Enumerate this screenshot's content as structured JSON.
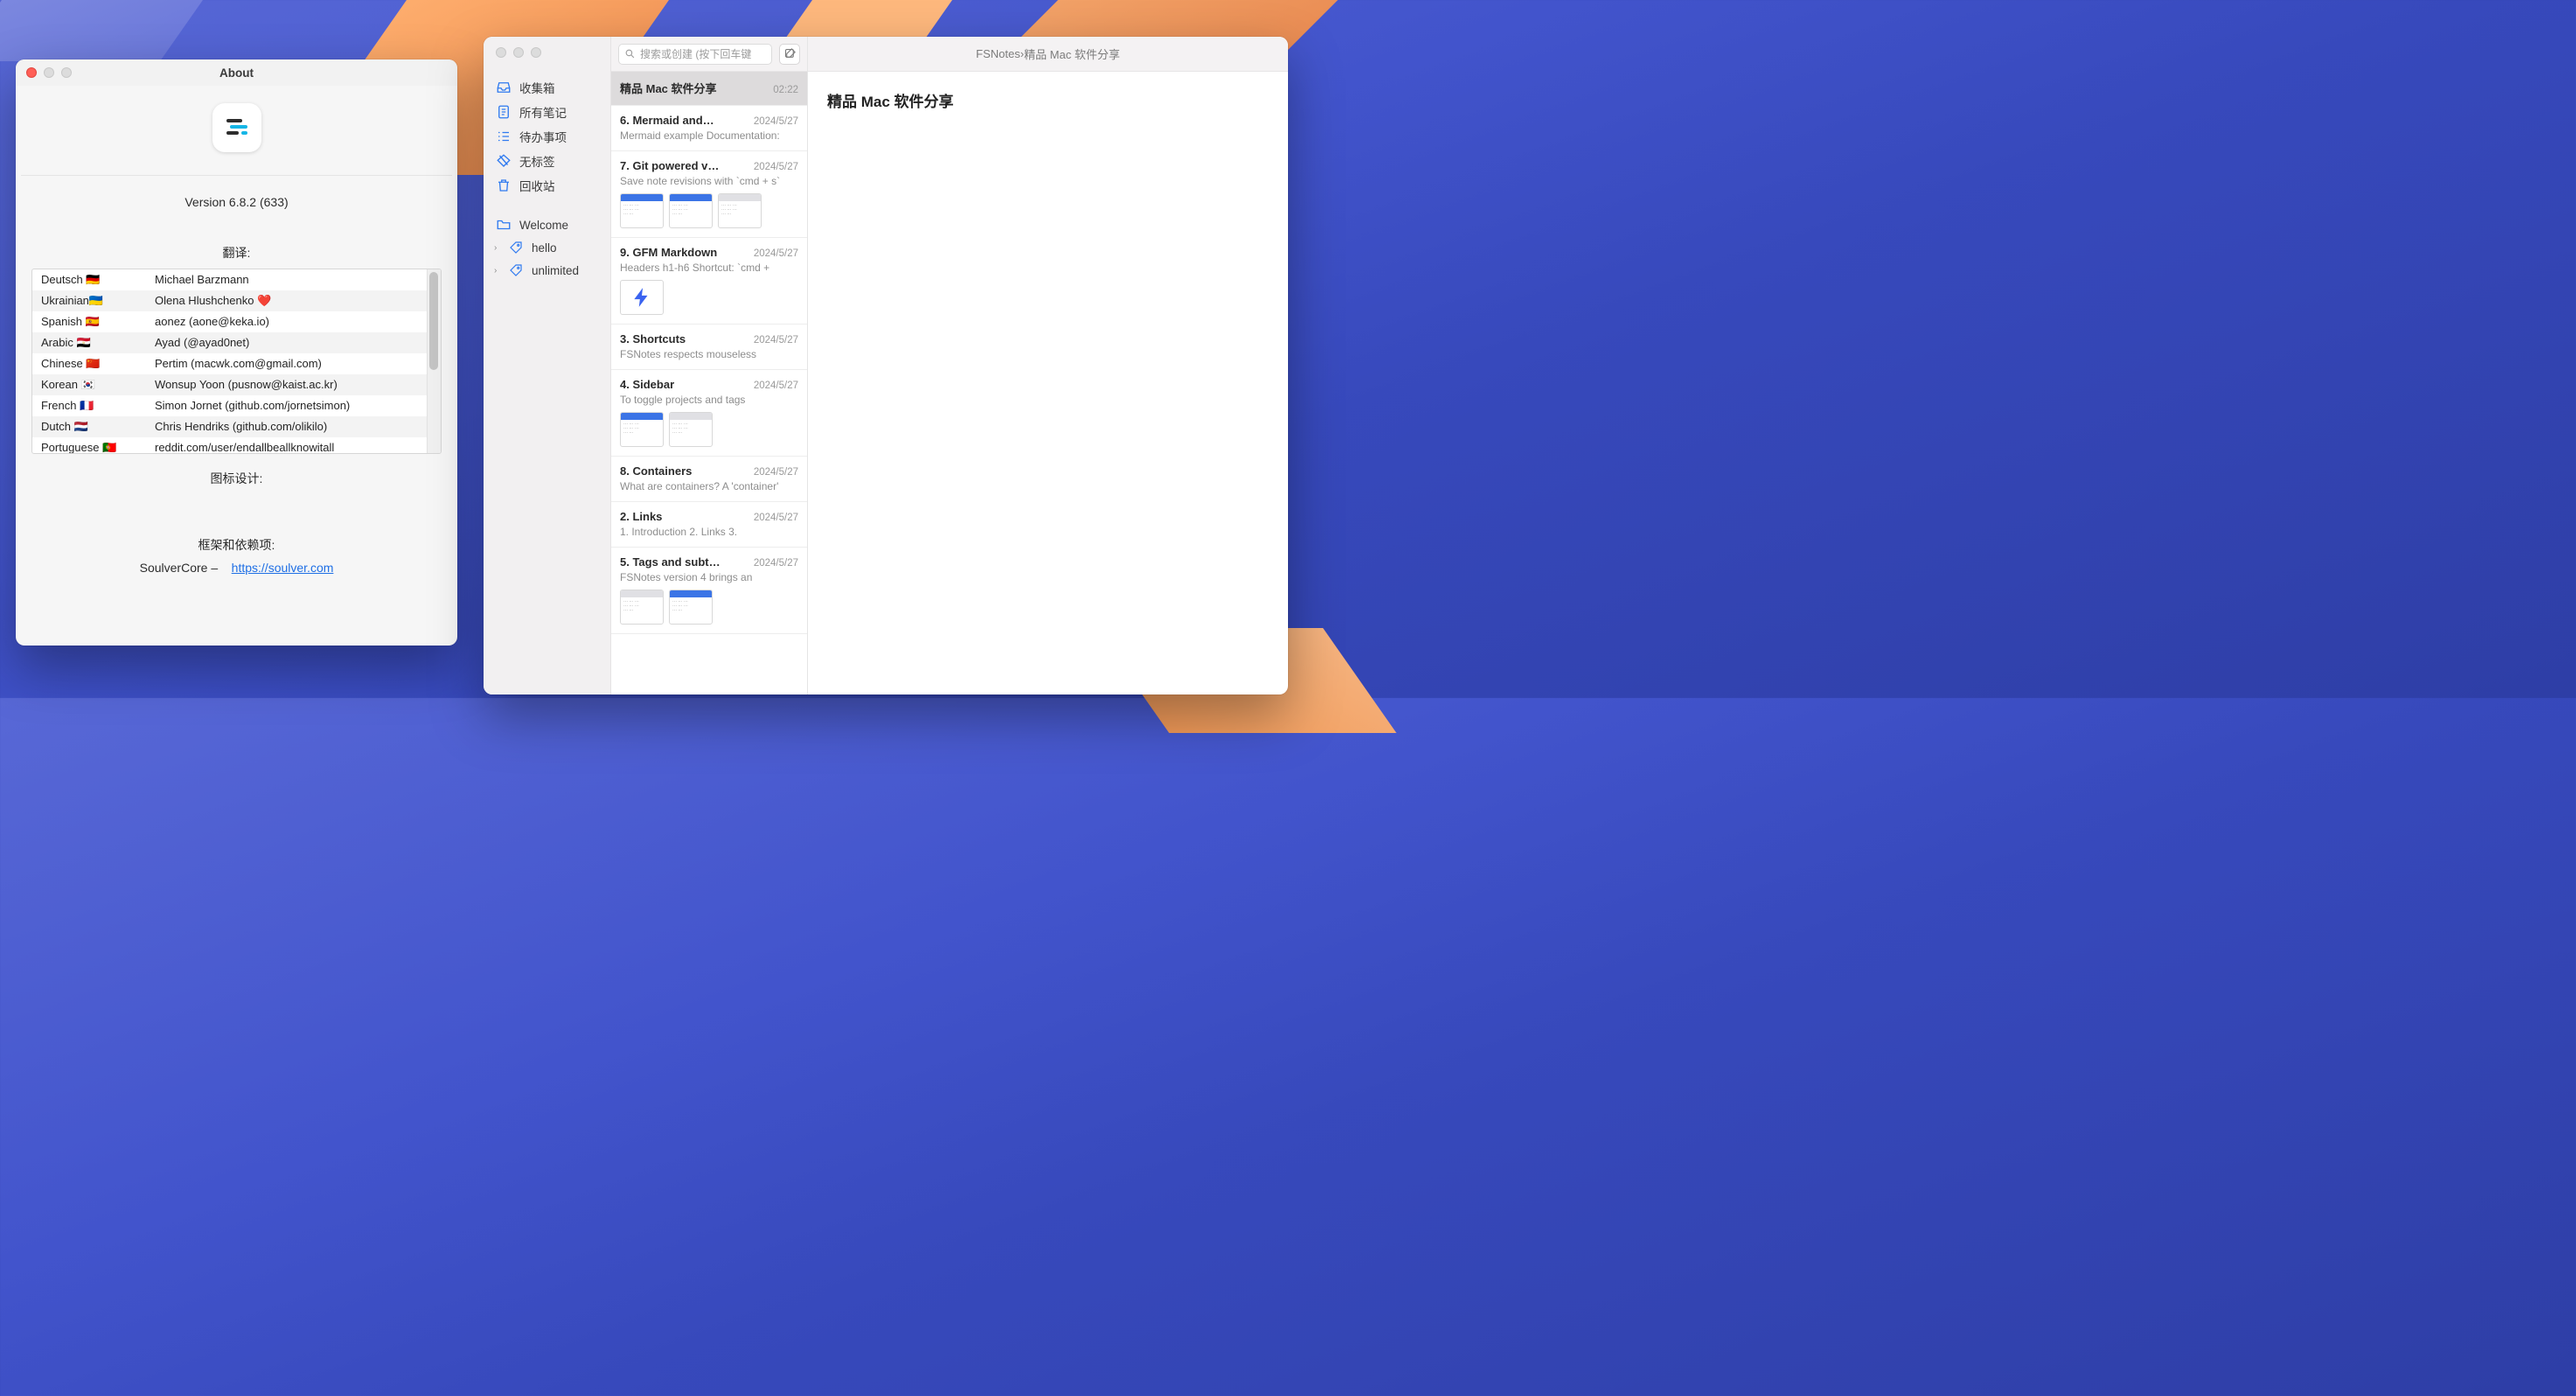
{
  "about": {
    "title": "About",
    "version": "Version 6.8.2 (633)",
    "translations_label": "翻译:",
    "icon_design_label": "图标设计:",
    "frameworks_label": "框架和依赖项:",
    "framework_name": "SoulverCore –",
    "framework_url": "https://soulver.com",
    "translations": [
      {
        "lang": "Deutsch 🇩🇪",
        "person": "Michael Barzmann"
      },
      {
        "lang": "Ukrainian🇺🇦",
        "person": "Olena Hlushchenko ❤️"
      },
      {
        "lang": "Spanish 🇪🇸",
        "person": "aonez (aone@keka.io)"
      },
      {
        "lang": "Arabic 🇪🇬",
        "person": "Ayad (@ayad0net)"
      },
      {
        "lang": "Chinese 🇨🇳",
        "person": "Pertim (macwk.com@gmail.com)"
      },
      {
        "lang": "Korean 🇰🇷",
        "person": "Wonsup Yoon (pusnow@kaist.ac.kr)"
      },
      {
        "lang": "French 🇫🇷",
        "person": "Simon Jornet (github.com/jornetsimon)"
      },
      {
        "lang": "Dutch 🇳🇱",
        "person": "Chris Hendriks (github.com/olikilo)"
      },
      {
        "lang": "Portuguese 🇵🇹",
        "person": "reddit.com/user/endallbeallknowitall"
      }
    ]
  },
  "fsnotes": {
    "search_placeholder": "搜索或创建 (按下回车键",
    "breadcrumb_app": "FSNotes",
    "breadcrumb_sep": " › ",
    "breadcrumb_note": "精品 Mac 软件分享",
    "editor_title": "精品 Mac 软件分享",
    "sidebar": {
      "inbox": "收集箱",
      "all": "所有笔记",
      "todo": "待办事项",
      "untagged": "无标签",
      "trash": "回收站",
      "welcome": "Welcome",
      "tag_hello": "hello",
      "tag_unlimited": "unlimited"
    },
    "notes": [
      {
        "title": "精品 Mac 软件分享",
        "time": "02:22",
        "snippet": "",
        "thumbs": 0
      },
      {
        "title": "6. Mermaid and…",
        "time": "2024/5/27",
        "snippet": "Mermaid example Documentation:",
        "thumbs": 0
      },
      {
        "title": "7. Git powered v…",
        "time": "2024/5/27",
        "snippet": "Save note revisions with `cmd + s`",
        "thumbs": 3
      },
      {
        "title": "9. GFM Markdown",
        "time": "2024/5/27",
        "snippet": "Headers h1-h6 Shortcut: `cmd +",
        "thumbs": "bolt"
      },
      {
        "title": "3. Shortcuts",
        "time": "2024/5/27",
        "snippet": "FSNotes respects mouseless",
        "thumbs": 0
      },
      {
        "title": "4. Sidebar",
        "time": "2024/5/27",
        "snippet": "To toggle projects and tags",
        "thumbs": 2
      },
      {
        "title": "8. Containers",
        "time": "2024/5/27",
        "snippet": "What are containers? A 'container'",
        "thumbs": 0
      },
      {
        "title": "2. Links",
        "time": "2024/5/27",
        "snippet": "1. Introduction 2. Links 3.",
        "thumbs": 0
      },
      {
        "title": "5. Tags and subt…",
        "time": "2024/5/27",
        "snippet": "FSNotes version 4 brings an",
        "thumbs": 2
      }
    ]
  }
}
